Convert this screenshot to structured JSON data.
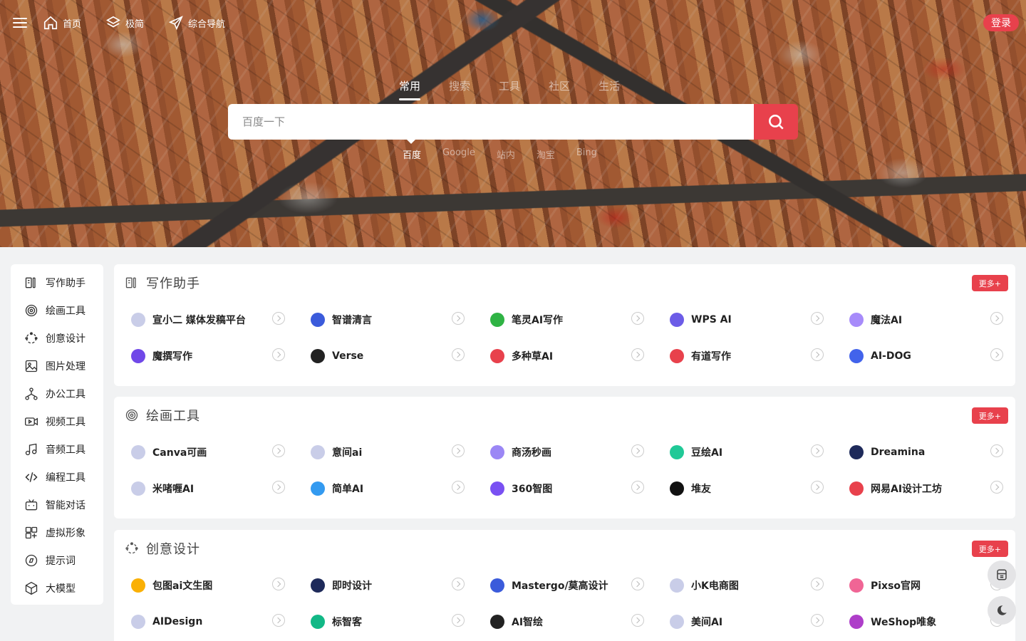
{
  "nav": {
    "items": [
      {
        "label": "首页",
        "icon": "home-icon"
      },
      {
        "label": "极简",
        "icon": "layers-icon"
      },
      {
        "label": "综合导航",
        "icon": "send-icon"
      }
    ],
    "login_label": "登录"
  },
  "search": {
    "tabs": [
      "常用",
      "搜索",
      "工具",
      "社区",
      "生活"
    ],
    "active_tab": "常用",
    "placeholder": "百度一下",
    "engines": [
      "百度",
      "Google",
      "站内",
      "淘宝",
      "Bing"
    ],
    "active_engine": "百度"
  },
  "sidebar": {
    "items": [
      {
        "label": "写作助手",
        "icon": "writing-icon"
      },
      {
        "label": "绘画工具",
        "icon": "spiral-icon"
      },
      {
        "label": "创意设计",
        "icon": "design-icon"
      },
      {
        "label": "图片处理",
        "icon": "image-icon"
      },
      {
        "label": "办公工具",
        "icon": "office-icon"
      },
      {
        "label": "视频工具",
        "icon": "video-icon"
      },
      {
        "label": "音频工具",
        "icon": "music-icon"
      },
      {
        "label": "编程工具",
        "icon": "code-icon"
      },
      {
        "label": "智能对话",
        "icon": "chat-bot-icon"
      },
      {
        "label": "虚拟形象",
        "icon": "avatar-icon"
      },
      {
        "label": "提示词",
        "icon": "compass-icon"
      },
      {
        "label": "大模型",
        "icon": "cube-icon"
      }
    ]
  },
  "sections": [
    {
      "title": "写作助手",
      "icon": "writing-icon",
      "more": "更多+",
      "items": [
        {
          "label": "宣小二 媒体发稿平台",
          "color": "#c9cde8"
        },
        {
          "label": "智谱清言",
          "color": "#3b5bdb"
        },
        {
          "label": "笔灵AI写作",
          "color": "#2fb344"
        },
        {
          "label": "WPS AI",
          "color": "#6c5ce7"
        },
        {
          "label": "魔法AI",
          "color": "#a78bfa"
        },
        {
          "label": "魔撰写作",
          "color": "#7048e8"
        },
        {
          "label": "Verse",
          "color": "#222222"
        },
        {
          "label": "多种草AI",
          "color": "#e8414c"
        },
        {
          "label": "有道写作",
          "color": "#e8414c"
        },
        {
          "label": "AI-DOG",
          "color": "#4263eb"
        }
      ]
    },
    {
      "title": "绘画工具",
      "icon": "spiral-icon",
      "more": "更多+",
      "items": [
        {
          "label": "Canva可画",
          "color": "#c9cde8"
        },
        {
          "label": "意间ai",
          "color": "#c9cde8"
        },
        {
          "label": "商汤秒画",
          "color": "#9b87f5"
        },
        {
          "label": "豆绘AI",
          "color": "#20c997"
        },
        {
          "label": "Dreamina",
          "color": "#1e2a5a"
        },
        {
          "label": "米啫喱AI",
          "color": "#c9cde8"
        },
        {
          "label": "简单AI",
          "color": "#339af0"
        },
        {
          "label": "360智图",
          "color": "#7950f2"
        },
        {
          "label": "堆友",
          "color": "#111111"
        },
        {
          "label": "网易AI设计工坊",
          "color": "#e8414c"
        }
      ]
    },
    {
      "title": "创意设计",
      "icon": "design-icon",
      "more": "更多+",
      "items": [
        {
          "label": "包图ai文生图",
          "color": "#fab005"
        },
        {
          "label": "即时设计",
          "color": "#1e2a5a"
        },
        {
          "label": "Mastergo/莫高设计",
          "color": "#3b5bdb"
        },
        {
          "label": "小K电商图",
          "color": "#c9cde8"
        },
        {
          "label": "Pixso官网",
          "color": "#f06595"
        },
        {
          "label": "AIDesign",
          "color": "#c9cde8"
        },
        {
          "label": "标智客",
          "color": "#12b886"
        },
        {
          "label": "AI智绘",
          "color": "#222222"
        },
        {
          "label": "美间AI",
          "color": "#c9cde8"
        },
        {
          "label": "WeShop唯象",
          "color": "#ae3ec9"
        }
      ]
    }
  ],
  "float_buttons": [
    {
      "icon": "calculator-icon"
    },
    {
      "icon": "moon-icon"
    }
  ]
}
